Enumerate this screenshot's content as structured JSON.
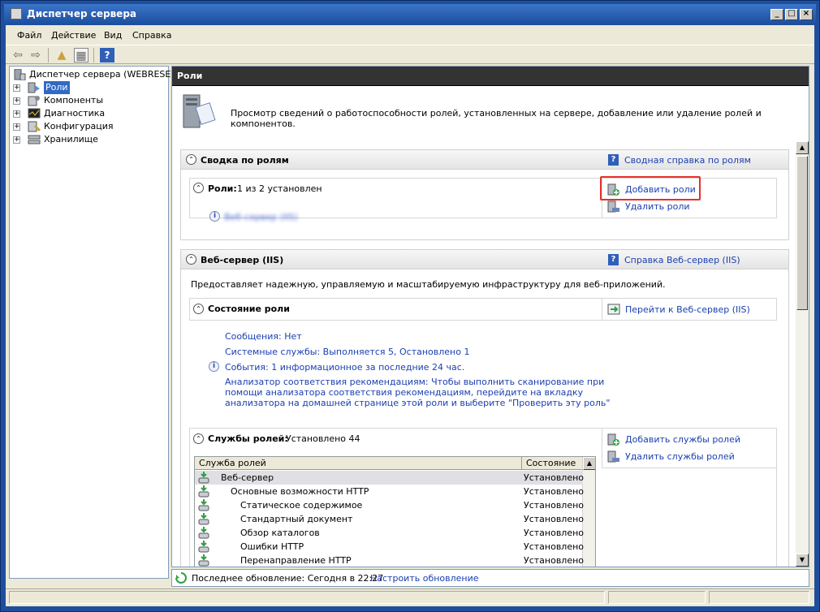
{
  "window": {
    "title": "Диспетчер сервера"
  },
  "menu": [
    "Файл",
    "Действие",
    "Вид",
    "Справка"
  ],
  "tree": {
    "root": "Диспетчер сервера (WEBRESE)",
    "items": [
      "Роли",
      "Компоненты",
      "Диагностика",
      "Конфигурация",
      "Хранилище"
    ],
    "selected": "Роли"
  },
  "pane": {
    "header": "Роли",
    "intro": "Просмотр сведений о работоспособности ролей, установленных на сервере, добавление или удаление ролей и компонентов."
  },
  "summary": {
    "title": "Сводка по ролям",
    "help_link": "Сводная справка по ролям",
    "roles_label": "Роли:",
    "roles_value": "1 из 2 установлен",
    "blurred_role": "Веб-сервер (IIS)",
    "add_roles": "Добавить роли",
    "remove_roles": "Удалить роли"
  },
  "iis": {
    "title": "Веб-сервер (IIS)",
    "help_link": "Справка Веб-сервер (IIS)",
    "description": "Предоставляет надежную, управляемую и масштабируемую инфраструктуру для веб-приложений.",
    "state_title": "Состояние роли",
    "goto_link": "Перейти к Веб-сервер (IIS)",
    "messages": "Сообщения: Нет",
    "services": "Системные службы: Выполняется 5, Остановлено 1",
    "events": "События: 1 информационное за последние 24 час.",
    "analyzer_lines": [
      "Анализатор соответствия рекомендациям: Чтобы выполнить сканирование при",
      "помощи анализатора соответствия рекомендациям, перейдите на вкладку",
      "анализатора на домашней странице этой роли и выберите \"Проверить эту роль\""
    ],
    "role_services_label": "Службы ролей:",
    "role_services_value": "Установлено 44",
    "add_services": "Добавить службы ролей",
    "remove_services": "Удалить службы ролей"
  },
  "role_table": {
    "columns": [
      "Служба ролей",
      "Состояние"
    ],
    "rows": [
      {
        "name": "Веб-сервер",
        "status": "Установлено",
        "indent": 0
      },
      {
        "name": "Основные возможности HTTP",
        "status": "Установлено",
        "indent": 1
      },
      {
        "name": "Статическое содержимое",
        "status": "Установлено",
        "indent": 2
      },
      {
        "name": "Стандартный документ",
        "status": "Установлено",
        "indent": 2
      },
      {
        "name": "Обзор каталогов",
        "status": "Установлено",
        "indent": 2
      },
      {
        "name": "Ошибки HTTP",
        "status": "Установлено",
        "indent": 2
      },
      {
        "name": "Перенаправление HTTP",
        "status": "Установлено",
        "indent": 2
      }
    ]
  },
  "status": {
    "last_update": "Последнее обновление: Сегодня в 22:27",
    "configure": "Настроить обновление"
  }
}
